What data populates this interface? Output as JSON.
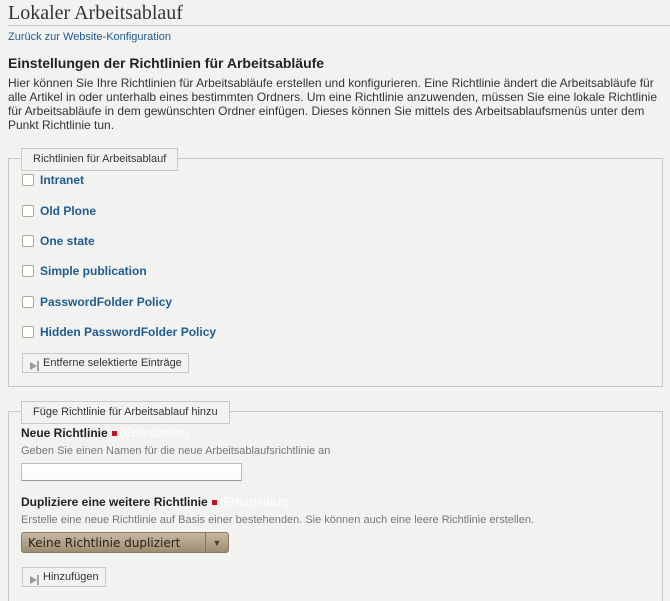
{
  "page": {
    "title": "Lokaler Arbeitsablauf",
    "back_link": "Zurück zur Website-Konfiguration"
  },
  "settings": {
    "heading": "Einstellungen der Richtlinien für Arbeitsabläufe",
    "description": "Hier können Sie Ihre Richtlinien für Arbeitsabläufe erstellen und konfigurieren. Eine Richtlinie ändert die Arbeitsabläufe für alle Artikel in oder unterhalb eines bestimmten Ordners. Um eine Richtlinie anzuwenden, müssen Sie eine lokale Richtlinie für Arbeitsabläufe in dem gewünschten Ordner einfügen. Dieses können Sie mittels des Arbeitsablaufsmenüs unter dem Punkt Richtlinie tun."
  },
  "policies_box": {
    "legend": "Richtlinien für Arbeitsablauf",
    "policies": [
      {
        "label": "Intranet",
        "checked": false
      },
      {
        "label": "Old Plone",
        "checked": false
      },
      {
        "label": "One state",
        "checked": false
      },
      {
        "label": "Simple publication",
        "checked": false
      },
      {
        "label": "PasswordFolder Policy",
        "checked": false
      },
      {
        "label": "Hidden PasswordFolder Policy",
        "checked": false
      }
    ],
    "remove_button": "Entferne selektierte Einträge"
  },
  "add_box": {
    "legend": "Füge Richtlinie für Arbeitsablauf hinzu",
    "new_policy": {
      "label": "Neue Richtlinie",
      "required_text": "(Erforderlich)",
      "help": "Geben Sie einen Namen für die neue Arbeitsablaufsrichtlinie an",
      "value": "",
      "placeholder": ""
    },
    "duplicate": {
      "label": "Dupliziere eine weitere Richtlinie",
      "required_text": "(Erforderlich)",
      "help": "Erstelle eine neue Richtlinie auf Basis einer bestehenden. Sie können auch eine leere Richtlinie erstellen.",
      "selected": "Keine Richtlinie dupliziert"
    },
    "add_button": "Hinzufügen"
  },
  "colors": {
    "link": "#205c90",
    "required": "#c5102a",
    "background": "#f2f2f0"
  }
}
